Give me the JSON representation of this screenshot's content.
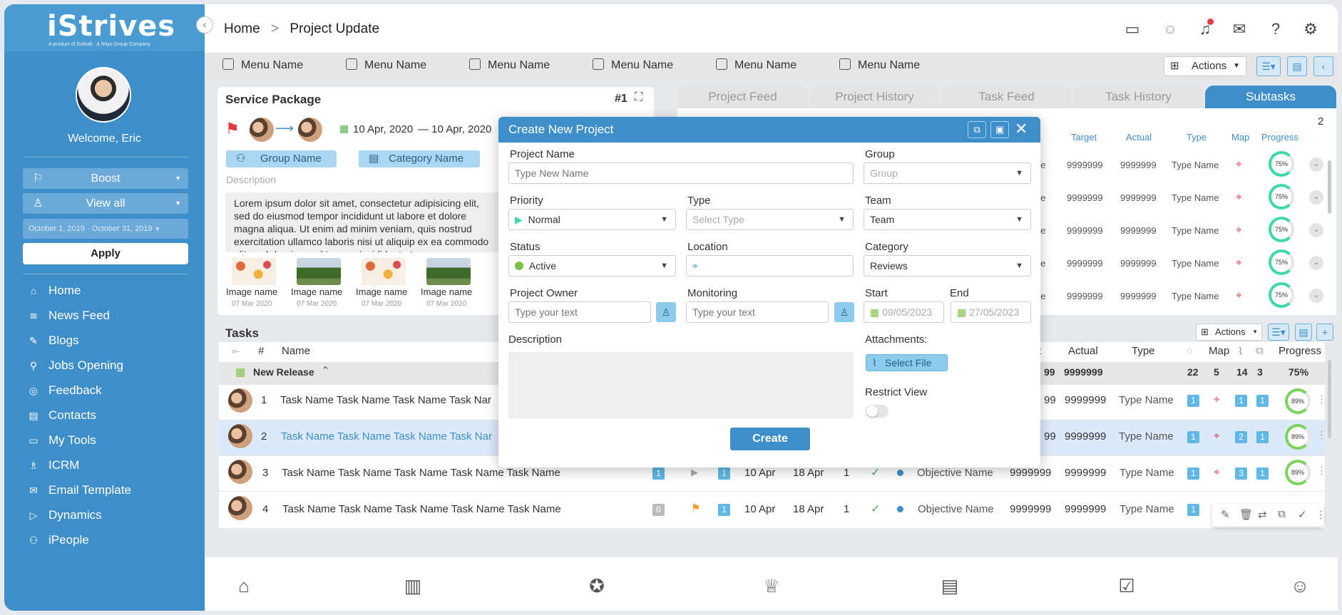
{
  "brand": {
    "name": "Strives",
    "tagline": "A product of Svilvalt  ·  A Nityo Group Company"
  },
  "sidebar": {
    "welcome": "Welcome, Eric",
    "boost": "Boost",
    "view_all": "View all",
    "date_range": "October 1, 2019 - October 31, 2019",
    "apply": "Apply",
    "items": [
      {
        "label": "Home",
        "icon": "home-icon"
      },
      {
        "label": "News Feed",
        "icon": "news-feed-icon"
      },
      {
        "label": "Blogs",
        "icon": "blogs-icon"
      },
      {
        "label": "Jobs Opening",
        "icon": "jobs-icon"
      },
      {
        "label": "Feedback",
        "icon": "feedback-icon"
      },
      {
        "label": "Contacts",
        "icon": "contacts-icon"
      },
      {
        "label": "My Tools",
        "icon": "tools-icon"
      },
      {
        "label": "ICRM",
        "icon": "icrm-icon"
      },
      {
        "label": "Email Template",
        "icon": "email-template-icon"
      },
      {
        "label": "Dynamics",
        "icon": "dynamics-icon"
      },
      {
        "label": "iPeople",
        "icon": "ipeople-icon"
      }
    ]
  },
  "header": {
    "crumb_home": "Home",
    "crumb_sep": ">",
    "crumb_current": "Project Update"
  },
  "menubar": {
    "items": [
      "Menu Name",
      "Menu Name",
      "Menu Name",
      "Menu Name",
      "Menu Name",
      "Menu Name"
    ],
    "actions": "Actions"
  },
  "service_package": {
    "title": "Service Package",
    "number": "#1",
    "date_start": "10 Apr, 2020",
    "date_end": "— 10 Apr, 2020",
    "group": "Group Name",
    "category": "Category Name",
    "description_label": "Description",
    "description": "Lorem ipsum dolor sit amet, consectetur adipisicing elit, sed do eiusmod tempor incididunt ut labore et dolore magna aliqua. Ut enim ad minim veniam, quis nostrud exercitation ullamco laboris nisi ut aliquip ex ea commodo elit, sed do eiusmod tempor incididunt ut...",
    "images": [
      {
        "name": "Image name",
        "date": "07 Mar 2020"
      },
      {
        "name": "Image name",
        "date": "07 Mar 2020"
      },
      {
        "name": "Image name",
        "date": "07 Mar 2020"
      },
      {
        "name": "Image name",
        "date": "07 Mar 2020"
      }
    ]
  },
  "tabs": [
    "Project Feed",
    "Project History",
    "Task Feed",
    "Task History",
    "Subtasks"
  ],
  "subtasks": {
    "count": "2",
    "headers": [
      "Target",
      "Actual",
      "Type",
      "Map",
      "Progress"
    ],
    "rows": [
      {
        "c": "ne",
        "target": "9999999",
        "actual": "9999999",
        "type": "Type Name",
        "progress": "75%"
      },
      {
        "c": "ne",
        "target": "9999999",
        "actual": "9999999",
        "type": "Type Name",
        "progress": "75%"
      },
      {
        "c": "ne",
        "target": "9999999",
        "actual": "9999999",
        "type": "Type Name",
        "progress": "75%"
      },
      {
        "c": "ne",
        "target": "9999999",
        "actual": "9999999",
        "type": "Type Name",
        "progress": "75%"
      },
      {
        "c": "ne",
        "target": "9999999",
        "actual": "9999999",
        "type": "Type Name",
        "progress": "75%"
      }
    ]
  },
  "tasks": {
    "title": "Tasks",
    "actions": "Actions",
    "headers": {
      "num": "#",
      "name": "Name",
      "t": "t",
      "actual": "Actual",
      "type": "Type",
      "map": "Map",
      "progress": "Progress"
    },
    "group": {
      "name": "New Release",
      "target": "99",
      "actual": "9999999",
      "c1": "22",
      "c2": "5",
      "c3": "14",
      "c4": "3",
      "progress": "75%"
    },
    "rows": [
      {
        "num": "1",
        "name": "Task Name Task Name Task Name Task Nar",
        "target": "99",
        "actual": "9999999",
        "type": "Type Name",
        "b1": "1",
        "b2": "1",
        "b3": "1",
        "progress": "89%"
      },
      {
        "num": "2",
        "name": "Task Name Task Name Task Name Task Nar",
        "target": "99",
        "actual": "9999999",
        "type": "Type Name",
        "b1": "1",
        "b2": "2",
        "b3": "1",
        "progress": "89%"
      },
      {
        "num": "3",
        "name": "Task Name Task Name Task Name Task Name Task Name",
        "badge": "1",
        "badge2": "1",
        "start": "10 Apr",
        "end": "18 Apr",
        "count": "1",
        "objective": "Objective Name",
        "target": "9999999",
        "actual": "9999999",
        "type": "Type Name",
        "b1": "1",
        "b2": "3",
        "b3": "1",
        "progress": "89%"
      },
      {
        "num": "4",
        "name": "Task Name Task Name Task Name Task Name Task Name",
        "badge": "0",
        "badge2": "1",
        "start": "10 Apr",
        "end": "18 Apr",
        "count": "1",
        "objective": "Objective Name",
        "target": "9999999",
        "actual": "9999999",
        "type": "Type Name",
        "b1": "1"
      }
    ]
  },
  "modal": {
    "title": "Create New Project",
    "project_name": {
      "label": "Project Name",
      "placeholder": "Type New Name"
    },
    "group": {
      "label": "Group",
      "placeholder": "Group"
    },
    "priority": {
      "label": "Priority",
      "value": "Normal"
    },
    "type": {
      "label": "Type",
      "placeholder": "Select Type"
    },
    "team": {
      "label": "Team",
      "value": "Team"
    },
    "status": {
      "label": "Status",
      "value": "Active"
    },
    "location": {
      "label": "Location"
    },
    "category": {
      "label": "Category",
      "value": "Reviews"
    },
    "owner": {
      "label": "Project Owner",
      "placeholder": "Type your text"
    },
    "monitoring": {
      "label": "Monitoring",
      "placeholder": "Type your text"
    },
    "start": {
      "label": "Start",
      "value": "09/05/2023"
    },
    "end": {
      "label": "End",
      "value": "27/05/2023"
    },
    "description": {
      "label": "Description"
    },
    "attachments": {
      "label": "Attachments:",
      "button": "Select File"
    },
    "restrict": {
      "label": "Restrict View"
    },
    "create": "Create"
  },
  "colors": {
    "primary": "#3d8ec9",
    "accent_light": "#a9d6f0",
    "ring_teal": "#3dd9a9",
    "ring_green": "#7bd35f",
    "flag_red": "#e63946"
  }
}
